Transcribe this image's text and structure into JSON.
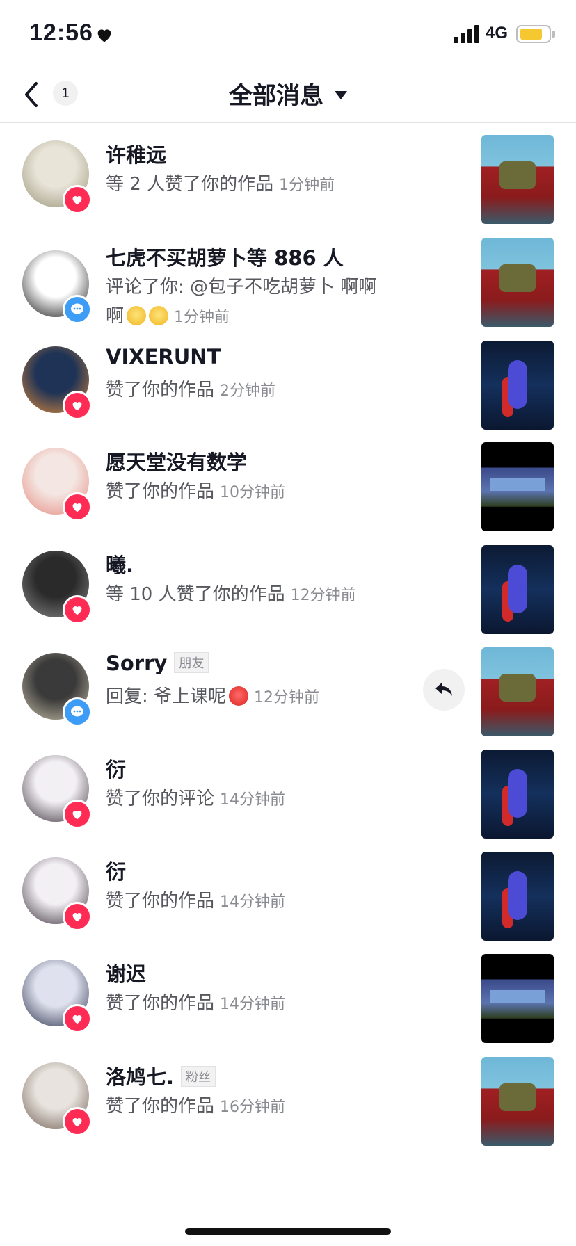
{
  "status_bar": {
    "time": "12:56",
    "network": "4G",
    "battery_level": 0.82
  },
  "nav": {
    "unread_count": "1",
    "title": "全部消息"
  },
  "notifications": [
    {
      "name": "许稚远",
      "tag": "",
      "text": "等 2 人赞了你的作品",
      "time": "1分钟前",
      "text2": "",
      "badge": "like",
      "thumb": "t1",
      "avatar": [
        "#e8e4d8",
        "#9a9478"
      ]
    },
    {
      "name": "七虎不买胡萝卜等 886 人",
      "tag": "",
      "text": "评论了你: @包子不吃胡萝卜 啊啊",
      "text2": "啊",
      "time": "1分钟前",
      "badge": "comment",
      "thumb": "t1",
      "avatar": [
        "#ffffff",
        "#111111"
      ]
    },
    {
      "name": "VIXERUNT",
      "tag": "",
      "text": "赞了你的作品",
      "time": "2分钟前",
      "text2": "",
      "badge": "like",
      "thumb": "t2",
      "avatar": [
        "#1e3356",
        "#e08b3a"
      ]
    },
    {
      "name": "愿天堂没有数学",
      "tag": "",
      "text": "赞了你的作品",
      "time": "10分钟前",
      "text2": "",
      "badge": "like",
      "thumb": "t3",
      "avatar": [
        "#f4e6e2",
        "#e48a7e"
      ]
    },
    {
      "name": "曦.",
      "tag": "",
      "text": "等 10 人赞了你的作品",
      "time": "12分钟前",
      "text2": "",
      "badge": "like",
      "thumb": "t2",
      "avatar": [
        "#2a2a2a",
        "#8a8a8a"
      ]
    },
    {
      "name": "Sorry",
      "tag": "朋友",
      "text": "回复: 爷上课呢",
      "time": "12分钟前",
      "text2": "",
      "badge": "comment",
      "thumb": "t1",
      "avatar": [
        "#3a3a3a",
        "#c8bfa8"
      ]
    },
    {
      "name": "衍",
      "tag": "",
      "text": "赞了你的评论",
      "time": "14分钟前",
      "text2": "",
      "badge": "like",
      "thumb": "t2",
      "avatar": [
        "#f3f0f4",
        "#3a2f3a"
      ]
    },
    {
      "name": "衍",
      "tag": "",
      "text": "赞了你的作品",
      "time": "14分钟前",
      "text2": "",
      "badge": "like",
      "thumb": "t2",
      "avatar": [
        "#f3f0f4",
        "#3a2f3a"
      ]
    },
    {
      "name": "谢迟",
      "tag": "",
      "text": "赞了你的作品",
      "time": "14分钟前",
      "text2": "",
      "badge": "like",
      "thumb": "t3",
      "avatar": [
        "#dfe2ee",
        "#2a2f4a"
      ]
    },
    {
      "name": "洛鸠七.",
      "tag": "粉丝",
      "text": "赞了你的作品",
      "time": "16分钟前",
      "text2": "",
      "badge": "like",
      "thumb": "t1",
      "avatar": [
        "#e8e3de",
        "#6f5e52"
      ]
    }
  ]
}
